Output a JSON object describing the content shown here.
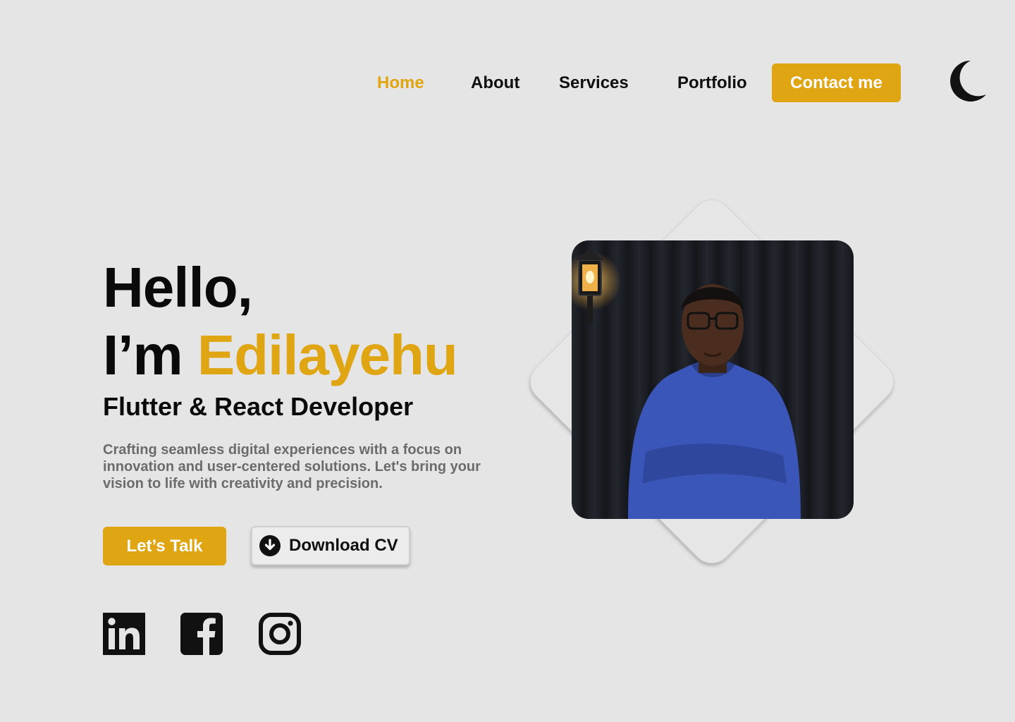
{
  "nav": {
    "items": [
      {
        "label": "Home",
        "active": true
      },
      {
        "label": "About",
        "active": false
      },
      {
        "label": "Services",
        "active": false
      },
      {
        "label": "Portfolio",
        "active": false
      }
    ],
    "contact_label": "Contact me",
    "theme_icon": "moon-icon"
  },
  "hero": {
    "greeting": "Hello,",
    "intro_prefix": "I’m ",
    "name": "Edilayehu",
    "role": "Flutter & React Developer",
    "description": "Crafting seamless digital experiences with a focus on innovation and user-centered solutions. Let's bring your vision to life with creativity and precision.",
    "primary_button": "Let’s Talk",
    "secondary_button": "Download CV",
    "secondary_icon": "download-icon"
  },
  "social": [
    {
      "icon": "linkedin-icon"
    },
    {
      "icon": "facebook-icon"
    },
    {
      "icon": "instagram-icon"
    }
  ],
  "colors": {
    "accent": "#e0a512",
    "background": "#e5e5e5",
    "text": "#0a0a0a",
    "muted": "#6b6b6b"
  }
}
